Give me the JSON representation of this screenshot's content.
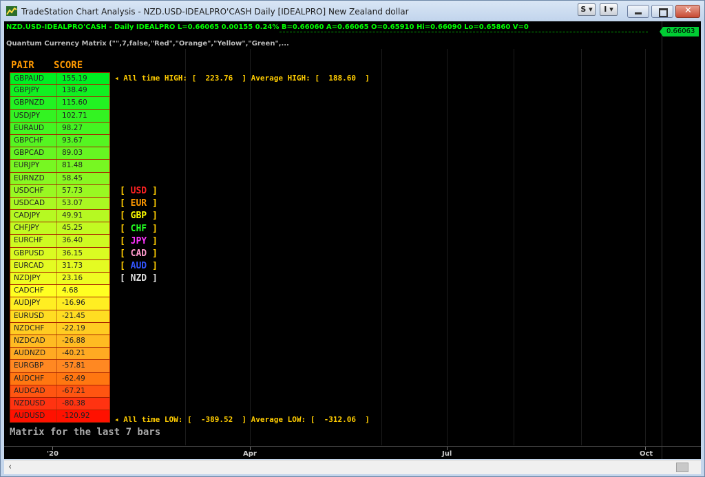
{
  "window": {
    "title": "TradeStation Chart Analysis - NZD.USD-IDEALPRO'CASH Daily [IDEALPRO] New Zealand dollar",
    "s_button": "S",
    "i_button": "I"
  },
  "chart": {
    "statusline": "NZD.USD-IDEALPRO'CASH - Daily  IDEALPRO  L=0.66065  0.00155  0.24%  B=0.66060  A=0.66065  O=0.65910  Hi=0.66090  Lo=0.65860  V=0",
    "last_price": "0.66063",
    "indicator_label": "Quantum Currency Matrix (\"\",7,false,\"Red\",\"Orange\",\"Yellow\",\"Green\",...",
    "header_pair": "PAIR",
    "header_score": "SCORE",
    "high_text": "◂ All time HIGH: [  223.76  ] Average HIGH: [  188.60  ]",
    "low_text": "◂ All time LOW: [  -389.52  ] Average LOW: [  -312.06  ]",
    "footer": "Matrix for the last 7 bars",
    "time_labels": [
      "'20",
      "Apr",
      "Jul",
      "Oct"
    ]
  },
  "matrix": [
    {
      "pair": "GBPAUD",
      "score": "155.19",
      "color": "#00ee22"
    },
    {
      "pair": "GBPJPY",
      "score": "138.49",
      "color": "#11f022"
    },
    {
      "pair": "GBPNZD",
      "score": "115.60",
      "color": "#22f222"
    },
    {
      "pair": "USDJPY",
      "score": "102.71",
      "color": "#33f322"
    },
    {
      "pair": "EURAUD",
      "score": "98.27",
      "color": "#44f422"
    },
    {
      "pair": "GBPCHF",
      "score": "93.67",
      "color": "#55f522"
    },
    {
      "pair": "GBPCAD",
      "score": "89.03",
      "color": "#66f622"
    },
    {
      "pair": "EURJPY",
      "score": "81.48",
      "color": "#77f722"
    },
    {
      "pair": "EURNZD",
      "score": "58.45",
      "color": "#88f722"
    },
    {
      "pair": "USDCHF",
      "score": "57.73",
      "color": "#99f822"
    },
    {
      "pair": "USDCAD",
      "score": "53.07",
      "color": "#aaf822"
    },
    {
      "pair": "CADJPY",
      "score": "49.91",
      "color": "#b6f922"
    },
    {
      "pair": "CHFJPY",
      "score": "45.25",
      "color": "#c2fa22"
    },
    {
      "pair": "EURCHF",
      "score": "36.40",
      "color": "#cefa22"
    },
    {
      "pair": "GBPUSD",
      "score": "36.15",
      "color": "#dafb22"
    },
    {
      "pair": "EURCAD",
      "score": "31.73",
      "color": "#e4fb22"
    },
    {
      "pair": "NZDJPY",
      "score": "23.16",
      "color": "#eefc22"
    },
    {
      "pair": "CADCHF",
      "score": "4.68",
      "color": "#ffff22"
    },
    {
      "pair": "AUDJPY",
      "score": "-16.96",
      "color": "#ffee22"
    },
    {
      "pair": "EURUSD",
      "score": "-21.45",
      "color": "#ffdd22"
    },
    {
      "pair": "NZDCHF",
      "score": "-22.19",
      "color": "#ffcc22"
    },
    {
      "pair": "NZDCAD",
      "score": "-26.88",
      "color": "#ffbb22"
    },
    {
      "pair": "AUDNZD",
      "score": "-40.21",
      "color": "#ffaa22"
    },
    {
      "pair": "EURGBP",
      "score": "-57.81",
      "color": "#ff8822"
    },
    {
      "pair": "AUDCHF",
      "score": "-62.49",
      "color": "#ff7711"
    },
    {
      "pair": "AUDCAD",
      "score": "-67.21",
      "color": "#ff5511"
    },
    {
      "pair": "NZDUSD",
      "score": "-80.38",
      "color": "#ff3311"
    },
    {
      "pair": "AUDUSD",
      "score": "-120.92",
      "color": "#ff1100"
    }
  ],
  "currencies": [
    {
      "code": "USD",
      "color": "#ff2222"
    },
    {
      "code": "EUR",
      "color": "#ff9900"
    },
    {
      "code": "GBP",
      "color": "#ffff00"
    },
    {
      "code": "CHF",
      "color": "#22ff22"
    },
    {
      "code": "JPY",
      "color": "#ff33ff"
    },
    {
      "code": "CAD",
      "color": "#ff99cc"
    },
    {
      "code": "AUD",
      "color": "#3355ff"
    },
    {
      "code": "NZD",
      "color": "#dddddd"
    }
  ]
}
